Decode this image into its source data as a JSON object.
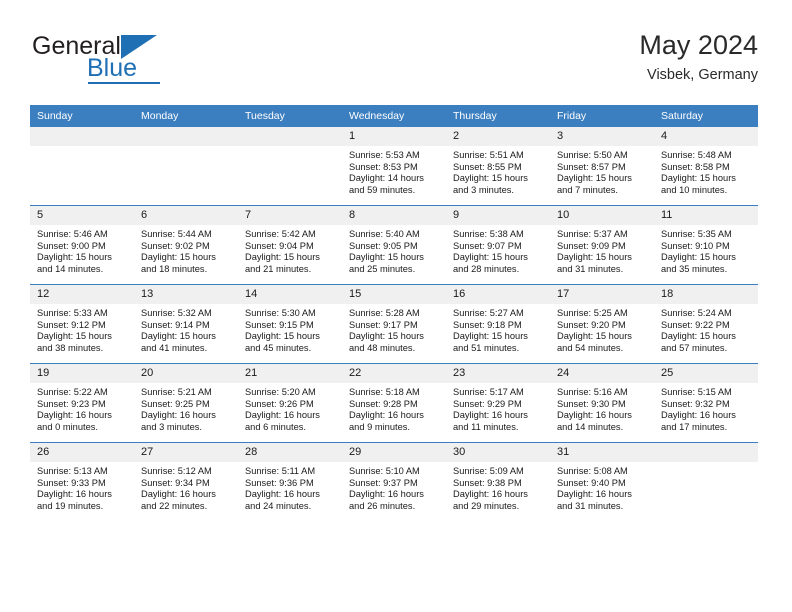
{
  "brand": {
    "name_part1": "General",
    "name_part2": "Blue",
    "logo_icon": "triangle-logo-icon"
  },
  "header": {
    "title": "May 2024",
    "subtitle": "Visbek, Germany"
  },
  "colors": {
    "header_blue": "#3c7fc0",
    "daynum_bg": "#f0f0f0",
    "brand_blue": "#1f6fb4",
    "text": "#1a1a1a"
  },
  "weekday_headers": [
    "Sunday",
    "Monday",
    "Tuesday",
    "Wednesday",
    "Thursday",
    "Friday",
    "Saturday"
  ],
  "weeks": [
    [
      {
        "day": "",
        "lines": []
      },
      {
        "day": "",
        "lines": []
      },
      {
        "day": "",
        "lines": []
      },
      {
        "day": "1",
        "lines": [
          "Sunrise: 5:53 AM",
          "Sunset: 8:53 PM",
          "Daylight: 14 hours",
          "and 59 minutes."
        ]
      },
      {
        "day": "2",
        "lines": [
          "Sunrise: 5:51 AM",
          "Sunset: 8:55 PM",
          "Daylight: 15 hours",
          "and 3 minutes."
        ]
      },
      {
        "day": "3",
        "lines": [
          "Sunrise: 5:50 AM",
          "Sunset: 8:57 PM",
          "Daylight: 15 hours",
          "and 7 minutes."
        ]
      },
      {
        "day": "4",
        "lines": [
          "Sunrise: 5:48 AM",
          "Sunset: 8:58 PM",
          "Daylight: 15 hours",
          "and 10 minutes."
        ]
      }
    ],
    [
      {
        "day": "5",
        "lines": [
          "Sunrise: 5:46 AM",
          "Sunset: 9:00 PM",
          "Daylight: 15 hours",
          "and 14 minutes."
        ]
      },
      {
        "day": "6",
        "lines": [
          "Sunrise: 5:44 AM",
          "Sunset: 9:02 PM",
          "Daylight: 15 hours",
          "and 18 minutes."
        ]
      },
      {
        "day": "7",
        "lines": [
          "Sunrise: 5:42 AM",
          "Sunset: 9:04 PM",
          "Daylight: 15 hours",
          "and 21 minutes."
        ]
      },
      {
        "day": "8",
        "lines": [
          "Sunrise: 5:40 AM",
          "Sunset: 9:05 PM",
          "Daylight: 15 hours",
          "and 25 minutes."
        ]
      },
      {
        "day": "9",
        "lines": [
          "Sunrise: 5:38 AM",
          "Sunset: 9:07 PM",
          "Daylight: 15 hours",
          "and 28 minutes."
        ]
      },
      {
        "day": "10",
        "lines": [
          "Sunrise: 5:37 AM",
          "Sunset: 9:09 PM",
          "Daylight: 15 hours",
          "and 31 minutes."
        ]
      },
      {
        "day": "11",
        "lines": [
          "Sunrise: 5:35 AM",
          "Sunset: 9:10 PM",
          "Daylight: 15 hours",
          "and 35 minutes."
        ]
      }
    ],
    [
      {
        "day": "12",
        "lines": [
          "Sunrise: 5:33 AM",
          "Sunset: 9:12 PM",
          "Daylight: 15 hours",
          "and 38 minutes."
        ]
      },
      {
        "day": "13",
        "lines": [
          "Sunrise: 5:32 AM",
          "Sunset: 9:14 PM",
          "Daylight: 15 hours",
          "and 41 minutes."
        ]
      },
      {
        "day": "14",
        "lines": [
          "Sunrise: 5:30 AM",
          "Sunset: 9:15 PM",
          "Daylight: 15 hours",
          "and 45 minutes."
        ]
      },
      {
        "day": "15",
        "lines": [
          "Sunrise: 5:28 AM",
          "Sunset: 9:17 PM",
          "Daylight: 15 hours",
          "and 48 minutes."
        ]
      },
      {
        "day": "16",
        "lines": [
          "Sunrise: 5:27 AM",
          "Sunset: 9:18 PM",
          "Daylight: 15 hours",
          "and 51 minutes."
        ]
      },
      {
        "day": "17",
        "lines": [
          "Sunrise: 5:25 AM",
          "Sunset: 9:20 PM",
          "Daylight: 15 hours",
          "and 54 minutes."
        ]
      },
      {
        "day": "18",
        "lines": [
          "Sunrise: 5:24 AM",
          "Sunset: 9:22 PM",
          "Daylight: 15 hours",
          "and 57 minutes."
        ]
      }
    ],
    [
      {
        "day": "19",
        "lines": [
          "Sunrise: 5:22 AM",
          "Sunset: 9:23 PM",
          "Daylight: 16 hours",
          "and 0 minutes."
        ]
      },
      {
        "day": "20",
        "lines": [
          "Sunrise: 5:21 AM",
          "Sunset: 9:25 PM",
          "Daylight: 16 hours",
          "and 3 minutes."
        ]
      },
      {
        "day": "21",
        "lines": [
          "Sunrise: 5:20 AM",
          "Sunset: 9:26 PM",
          "Daylight: 16 hours",
          "and 6 minutes."
        ]
      },
      {
        "day": "22",
        "lines": [
          "Sunrise: 5:18 AM",
          "Sunset: 9:28 PM",
          "Daylight: 16 hours",
          "and 9 minutes."
        ]
      },
      {
        "day": "23",
        "lines": [
          "Sunrise: 5:17 AM",
          "Sunset: 9:29 PM",
          "Daylight: 16 hours",
          "and 11 minutes."
        ]
      },
      {
        "day": "24",
        "lines": [
          "Sunrise: 5:16 AM",
          "Sunset: 9:30 PM",
          "Daylight: 16 hours",
          "and 14 minutes."
        ]
      },
      {
        "day": "25",
        "lines": [
          "Sunrise: 5:15 AM",
          "Sunset: 9:32 PM",
          "Daylight: 16 hours",
          "and 17 minutes."
        ]
      }
    ],
    [
      {
        "day": "26",
        "lines": [
          "Sunrise: 5:13 AM",
          "Sunset: 9:33 PM",
          "Daylight: 16 hours",
          "and 19 minutes."
        ]
      },
      {
        "day": "27",
        "lines": [
          "Sunrise: 5:12 AM",
          "Sunset: 9:34 PM",
          "Daylight: 16 hours",
          "and 22 minutes."
        ]
      },
      {
        "day": "28",
        "lines": [
          "Sunrise: 5:11 AM",
          "Sunset: 9:36 PM",
          "Daylight: 16 hours",
          "and 24 minutes."
        ]
      },
      {
        "day": "29",
        "lines": [
          "Sunrise: 5:10 AM",
          "Sunset: 9:37 PM",
          "Daylight: 16 hours",
          "and 26 minutes."
        ]
      },
      {
        "day": "30",
        "lines": [
          "Sunrise: 5:09 AM",
          "Sunset: 9:38 PM",
          "Daylight: 16 hours",
          "and 29 minutes."
        ]
      },
      {
        "day": "31",
        "lines": [
          "Sunrise: 5:08 AM",
          "Sunset: 9:40 PM",
          "Daylight: 16 hours",
          "and 31 minutes."
        ]
      },
      {
        "day": "",
        "lines": []
      }
    ]
  ]
}
